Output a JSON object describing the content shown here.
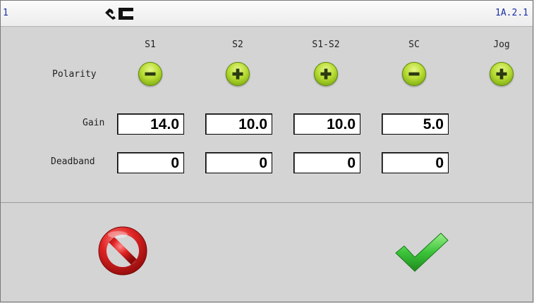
{
  "header": {
    "left_id": "1",
    "right_id": "1A.2.1",
    "logo_icon": "machine-logo-icon"
  },
  "columns": [
    "S1",
    "S2",
    "S1-S2",
    "SC",
    "Jog"
  ],
  "polarity": {
    "label": "Polarity",
    "values": [
      "minus",
      "plus",
      "plus",
      "minus",
      "plus"
    ]
  },
  "gain": {
    "label": "Gain",
    "values": [
      "14.0",
      "10.0",
      "10.0",
      "5.0"
    ]
  },
  "deadband": {
    "label": "Deadband",
    "values": [
      "0",
      "0",
      "0",
      "0"
    ]
  },
  "actions": {
    "cancel_icon": "cancel-prohibited-icon",
    "confirm_icon": "checkmark-icon"
  },
  "colors": {
    "accent_green": "#8fc21a",
    "cancel_red": "#d92020",
    "header_text": "#1b2fa5"
  }
}
